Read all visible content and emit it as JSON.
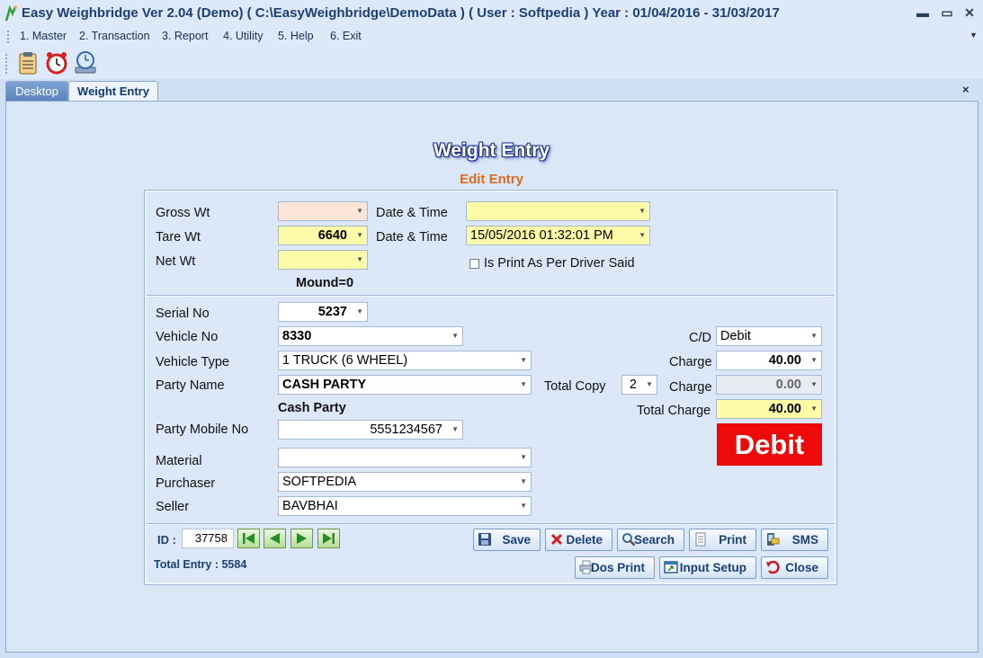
{
  "window": {
    "title": "Easy Weighbridge Ver 2.04 (Demo)    ( C:\\EasyWeighbridge\\DemoData ) ( User : Softpedia ) Year : 01/04/2016 - 31/03/2017",
    "minimize": "▬",
    "maximize": "▭",
    "close": "✕"
  },
  "menu": [
    "1. Master",
    "2. Transaction",
    "3. Report",
    "4. Utility",
    "5. Help",
    "6. Exit"
  ],
  "toolbar_icons": [
    "clipboard-icon",
    "alarm-clock-icon",
    "backup-icon"
  ],
  "tabs": [
    {
      "label": "Desktop",
      "active": false
    },
    {
      "label": "Weight Entry",
      "active": true
    }
  ],
  "tab_close": "×",
  "form": {
    "heading": "Weight Entry",
    "subheading": "Edit Entry",
    "gross_wt": {
      "label": "Gross Wt",
      "value": ""
    },
    "tare_wt": {
      "label": "Tare Wt",
      "value": "6640"
    },
    "net_wt": {
      "label": "Net Wt",
      "value": ""
    },
    "date_time_1": {
      "label": "Date & Time",
      "value": ""
    },
    "date_time_2": {
      "label": "Date & Time",
      "value": "15/05/2016 01:32:01 PM"
    },
    "print_as_driver": {
      "label": "Is Print As Per Driver Said",
      "checked": false
    },
    "mound": "Mound=0",
    "serial_no": {
      "label": "Serial No",
      "value": "5237"
    },
    "vehicle_no": {
      "label": "Vehicle No",
      "value": "8330"
    },
    "vehicle_type": {
      "label": "Vehicle Type",
      "value": "1 TRUCK (6 WHEEL)"
    },
    "party_name": {
      "label": "Party Name",
      "value": "CASH PARTY"
    },
    "party_display": "Cash Party",
    "party_mobile": {
      "label": "Party Mobile No",
      "value": "5551234567"
    },
    "material": {
      "label": "Material",
      "value": ""
    },
    "purchaser": {
      "label": "Purchaser",
      "value": "SOFTPEDIA"
    },
    "seller": {
      "label": "Seller",
      "value": "BAVBHAI"
    },
    "total_copy": {
      "label": "Total Copy",
      "value": "2"
    },
    "cd": {
      "label": "C/D",
      "value": "Debit"
    },
    "charge_1": {
      "label": "Charge",
      "value": "40.00"
    },
    "charge_2": {
      "label": "Charge",
      "value": "0.00"
    },
    "total_charge": {
      "label": "Total Charge",
      "value": "40.00"
    },
    "badge": "Debit",
    "id": {
      "label": "ID :",
      "value": "37758"
    },
    "total_entry": "Total Entry : 5584"
  },
  "buttons": {
    "save": "Save",
    "delete": "Delete",
    "search": "Search",
    "print": "Print",
    "sms": "SMS",
    "dos_print": "Dos Print",
    "input_setup": "Input Setup",
    "close": "Close"
  },
  "colors": {
    "title_text": "#1e3f73",
    "subheading": "#e06a1a",
    "badge_bg": "#ee0a0a",
    "yellow_field": "#fdfaa8"
  }
}
